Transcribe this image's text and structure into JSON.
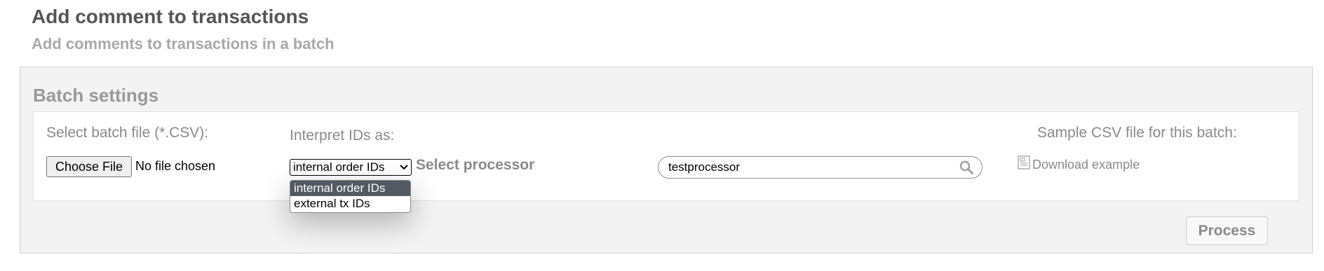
{
  "header": {
    "title": "Add comment to transactions",
    "subtitle": "Add comments to transactions in a batch"
  },
  "panel": {
    "title": "Batch settings",
    "batch_file": {
      "label": "Select batch file (*.CSV):",
      "choose_button": "Choose File",
      "status": "No file chosen"
    },
    "interpret": {
      "label": "Interpret IDs as:",
      "selected": "internal order IDs",
      "options": [
        "internal order IDs",
        "external tx IDs"
      ]
    },
    "processor": {
      "label": "Select processor",
      "value": "testprocessor",
      "icon": "search-icon"
    },
    "sample": {
      "label": "Sample CSV file for this batch:",
      "download_label": "Download example",
      "icon": "csv-file-icon"
    },
    "process_button": "Process"
  },
  "colors": {
    "selected_option_bg": "#535a64",
    "panel_bg": "#f3f3f3",
    "label_text": "#8a8a8a",
    "title_text": "#555555"
  }
}
